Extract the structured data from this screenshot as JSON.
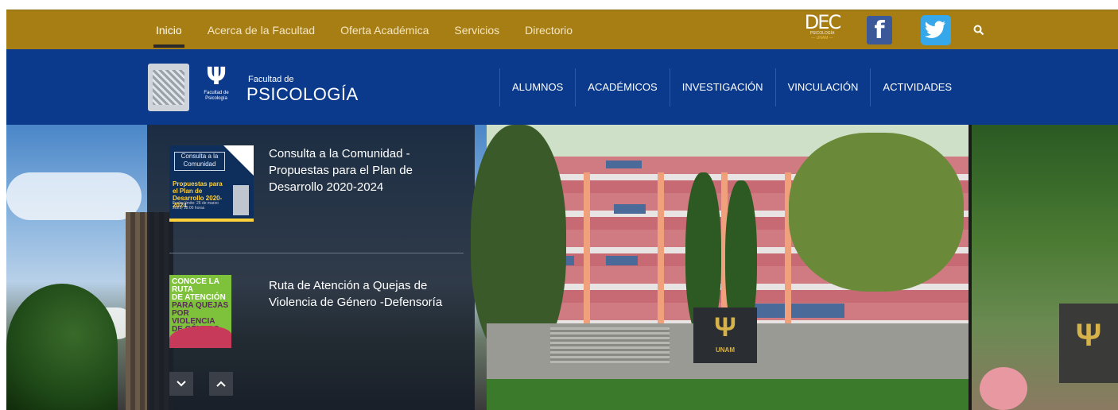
{
  "topbar": {
    "nav": [
      "Inicio",
      "Acerca de la Facultad",
      "Oferta Académica",
      "Servicios",
      "Directorio"
    ],
    "active_index": 0,
    "dec_logo": {
      "big": "DEC",
      "line1": "PSICOLOGÍA",
      "line2": "— UNAM —"
    },
    "facebook_label": "f",
    "bg_color": "#a77e14"
  },
  "header": {
    "fac_glyph": "Ψ",
    "fac_logo_label": "Facultad de Psicología",
    "fac_de": "Facultad de",
    "fac_name": "PSICOLOGÍA",
    "nav": [
      "ALUMNOS",
      "ACADÉMICOS",
      "INVESTIGACIÓN",
      "VINCULACIÓN",
      "ACTIVIDADES"
    ],
    "bg_color": "#0b3a8c"
  },
  "news": {
    "items": [
      {
        "title": "Consulta a la Comunidad - Propuestas para el Plan de Desarrollo 2020-2024",
        "thumb_box": "Consulta a la Comunidad",
        "thumb_headline": "Propuestas para el Plan de Desarrollo 2020-2024",
        "thumb_small": "Fecha límite: 26 de marzo 2021, 18:00 horas"
      },
      {
        "title": "Ruta de Atención a Quejas de Violencia de Género -Defensoría",
        "thumb_line1": "CONOCE LA RUTA",
        "thumb_line2": "DE ATENCIÓN",
        "thumb_line3": "PARA QUEJAS",
        "thumb_line4": "POR VIOLENCIA",
        "thumb_line5": "DE GÉNERO"
      }
    ],
    "down_label": "⌄",
    "up_label": "⌃"
  },
  "hero": {
    "sign_glyph": "Ψ",
    "sign_text": "UNAM",
    "right_sign_glyph": "Ψ"
  }
}
